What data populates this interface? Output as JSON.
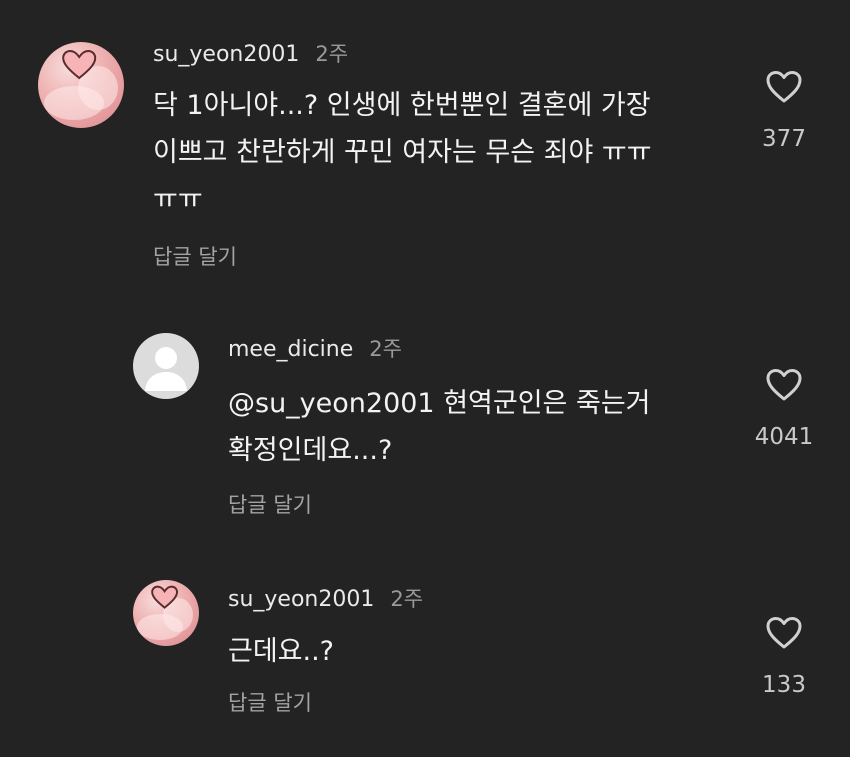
{
  "comments": [
    {
      "username": "su_yeon2001",
      "time": "2주",
      "text_lines": [
        "닥 1아니야...? 인생에 한번뿐인 결혼에 가장",
        "이쁘고 찬란하게 꾸민 여자는 무슨 죄야 ㅠㅠ",
        "ㅠㅠ"
      ],
      "reply_label": "답글 달기",
      "like_count": "377"
    },
    {
      "username": "mee_dicine",
      "time": "2주",
      "text_lines": [
        "@su_yeon2001 현역군인은 죽는거",
        "확정인데요...?"
      ],
      "reply_label": "답글 달기",
      "like_count": "4041"
    },
    {
      "username": "su_yeon2001",
      "time": "2주",
      "text_lines": [
        "근데요..?"
      ],
      "reply_label": "답글 달기",
      "like_count": "133"
    }
  ],
  "icons": {
    "like": "heart-outline-icon",
    "avatar_pink": "pink-heart-profile-photo",
    "avatar_default": "default-user-silhouette"
  },
  "colors": {
    "background": "#232323",
    "text": "#f3f3f3",
    "muted": "#9a9a9a",
    "like_outline": "#d0d0d0"
  }
}
